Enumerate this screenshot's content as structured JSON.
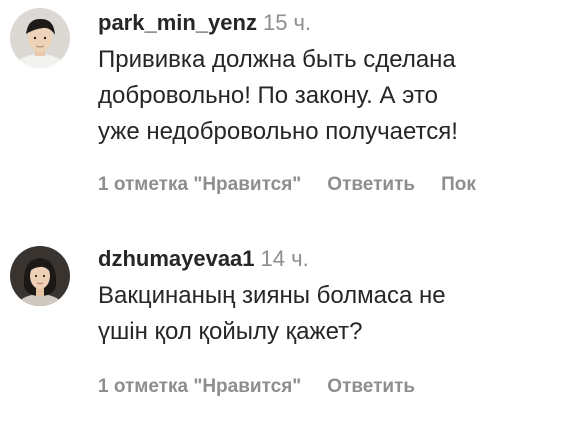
{
  "comments": [
    {
      "username": "park_min_yenz",
      "time": "15 ч.",
      "text_lines": [
        "Прививка должна быть сделана",
        "добровольно! По закону. А это",
        "уже недобровольно получается!"
      ],
      "likes": "1 отметка \"Нравится\"",
      "reply": "Ответить",
      "more": "Пок"
    },
    {
      "username": "dzhumayevaa1",
      "time": "14 ч.",
      "text_lines": [
        "Вакцинаның зияны болмаса не",
        "үшін қол қойылу қажет?"
      ],
      "likes": "1 отметка \"Нравится\"",
      "reply": "Ответить"
    }
  ],
  "colors": {
    "primary_text": "#262626",
    "secondary_text": "#8e8e8e",
    "background": "#ffffff"
  }
}
